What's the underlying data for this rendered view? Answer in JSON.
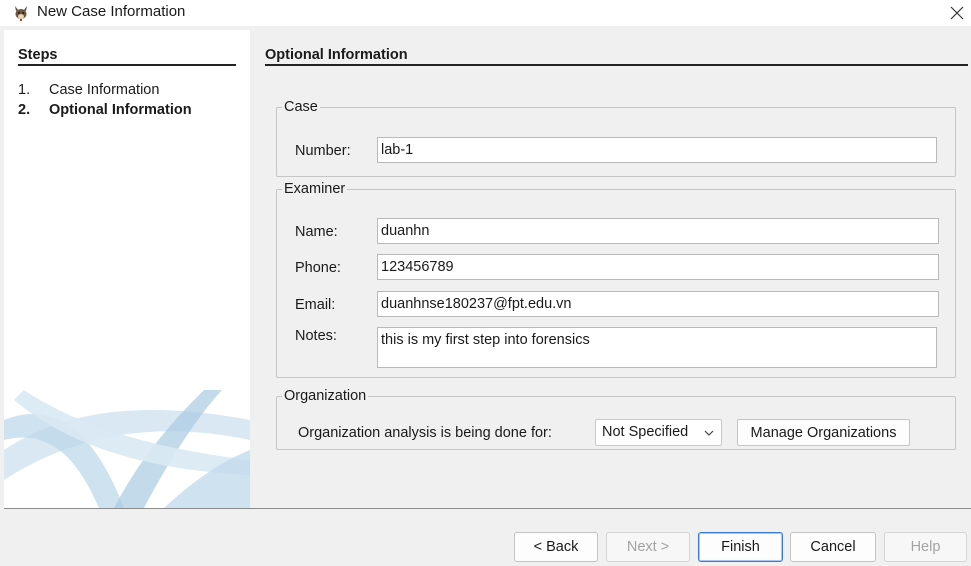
{
  "window": {
    "title": "New Case Information",
    "icon": "autopsy-dog-icon",
    "close_icon": "close-icon"
  },
  "steps": {
    "header": "Steps",
    "items": [
      {
        "num": "1.",
        "label": "Case Information",
        "active": false
      },
      {
        "num": "2.",
        "label": "Optional Information",
        "active": true
      }
    ]
  },
  "content": {
    "header": "Optional Information",
    "case": {
      "legend": "Case",
      "number_label": "Number:",
      "number_value": "lab-1"
    },
    "examiner": {
      "legend": "Examiner",
      "name_label": "Name:",
      "name_value": "duanhn",
      "phone_label": "Phone:",
      "phone_value": "123456789",
      "email_label": "Email:",
      "email_value": "duanhnse180237@fpt.edu.vn",
      "notes_label": "Notes:",
      "notes_value": "this is my first step into forensics"
    },
    "organization": {
      "legend": "Organization",
      "analysis_label": "Organization analysis is being done for:",
      "selected": "Not Specified",
      "manage_label": "Manage Organizations"
    }
  },
  "buttons": {
    "back": "< Back",
    "next": "Next >",
    "finish": "Finish",
    "cancel": "Cancel",
    "help": "Help"
  },
  "colors": {
    "window_bg": "#f0f0f0",
    "panel_bg": "#ffffff",
    "default_button_border": "#3a7ad1",
    "swoosh": "#a9cbe3"
  }
}
